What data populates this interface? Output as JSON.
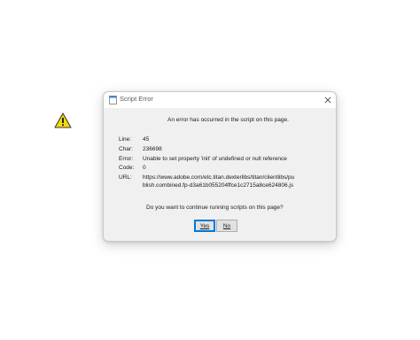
{
  "dialog": {
    "title": "Script Error",
    "message": "An error has occurred in the script on this page.",
    "fields": [
      {
        "label": "Line:",
        "value": "45"
      },
      {
        "label": "Char:",
        "value": "236698"
      },
      {
        "label": "Error:",
        "value": "Unable to set property 'init' of undefined or null reference"
      },
      {
        "label": "Code:",
        "value": "0"
      },
      {
        "label": "URL:",
        "value_line1": "https://www.adobe.com/etc.titan.dexterlibs/titan/clientlibs/pu",
        "value_line2": "blish.combined.fp-d3a61b055204ffce1c2715a8ce624806.js"
      }
    ],
    "question": "Do you want to continue running scripts on this page?",
    "yes_label": "Yes",
    "no_label": "No"
  },
  "icons": {
    "app": "document-icon",
    "close": "close-icon",
    "warning": "warning-icon"
  },
  "colors": {
    "dialog_bg": "#f0f0f0",
    "titlebar_bg": "#ffffff",
    "warning_fill": "#f5d90f",
    "default_button_border": "#0078d7"
  }
}
